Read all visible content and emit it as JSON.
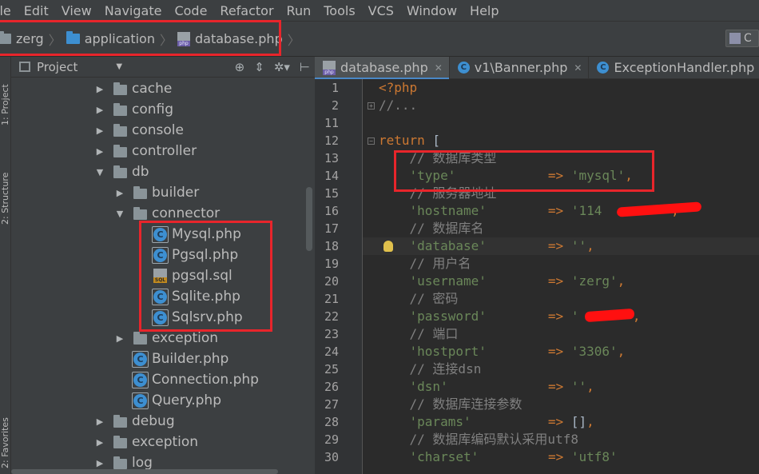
{
  "menu": [
    "ile",
    "Edit",
    "View",
    "Navigate",
    "Code",
    "Refactor",
    "Run",
    "Tools",
    "VCS",
    "Window",
    "Help"
  ],
  "breadcrumb": [
    {
      "label": "zerg",
      "icon": "folder-icon"
    },
    {
      "label": "application",
      "icon": "folder-icon"
    },
    {
      "label": "database.php",
      "icon": "php-file-icon"
    }
  ],
  "navbar_right_label": "C",
  "left_tabs": {
    "project": "1: Project",
    "structure": "2: Structure",
    "favorites": "2: Favorites"
  },
  "project_panel": {
    "title": "Project",
    "tools": [
      "⊕",
      "⇕",
      "✲▾",
      "⊢"
    ]
  },
  "tree": [
    {
      "label": "cache",
      "type": "folder",
      "depth": 0,
      "state": "collapsed"
    },
    {
      "label": "config",
      "type": "folder",
      "depth": 0,
      "state": "collapsed"
    },
    {
      "label": "console",
      "type": "folder",
      "depth": 0,
      "state": "collapsed"
    },
    {
      "label": "controller",
      "type": "folder",
      "depth": 0,
      "state": "collapsed"
    },
    {
      "label": "db",
      "type": "folder",
      "depth": 0,
      "state": "expanded"
    },
    {
      "label": "builder",
      "type": "folder",
      "depth": 1,
      "state": "collapsed"
    },
    {
      "label": "connector",
      "type": "folder",
      "depth": 1,
      "state": "expanded"
    },
    {
      "label": "Mysql.php",
      "type": "class",
      "depth": 2
    },
    {
      "label": "Pgsql.php",
      "type": "class",
      "depth": 2
    },
    {
      "label": "pgsql.sql",
      "type": "sql",
      "depth": 2
    },
    {
      "label": "Sqlite.php",
      "type": "class",
      "depth": 2
    },
    {
      "label": "Sqlsrv.php",
      "type": "class",
      "depth": 2
    },
    {
      "label": "exception",
      "type": "folder",
      "depth": 1,
      "state": "collapsed"
    },
    {
      "label": "Builder.php",
      "type": "class",
      "depth": 1
    },
    {
      "label": "Connection.php",
      "type": "class",
      "depth": 1
    },
    {
      "label": "Query.php",
      "type": "class",
      "depth": 1
    },
    {
      "label": "debug",
      "type": "folder",
      "depth": 0,
      "state": "collapsed"
    },
    {
      "label": "exception",
      "type": "folder",
      "depth": 0,
      "state": "collapsed"
    },
    {
      "label": "log",
      "type": "folder",
      "depth": 0,
      "state": "collapsed"
    }
  ],
  "tabs": [
    {
      "label": "database.php",
      "icon": "php-file-icon",
      "active": true
    },
    {
      "label": "v1\\Banner.php",
      "icon": "class-icon",
      "active": false
    },
    {
      "label": "ExceptionHandler.php",
      "icon": "class-icon",
      "active": false
    }
  ],
  "code_lines": [
    {
      "n": "1",
      "parts": [
        {
          "t": "<?php",
          "c": "kw"
        }
      ]
    },
    {
      "n": "2",
      "parts": [
        {
          "t": "//...",
          "c": "cmt"
        }
      ]
    },
    {
      "n": "11",
      "parts": []
    },
    {
      "n": "12",
      "parts": [
        {
          "t": "return",
          "c": "kw"
        },
        {
          "t": " [",
          "c": "pn"
        }
      ]
    },
    {
      "n": "13",
      "parts": [
        {
          "t": "    // 数据库类型",
          "c": "cmt"
        }
      ]
    },
    {
      "n": "14",
      "parts": [
        {
          "t": "    'type'",
          "c": "str"
        },
        {
          "t": "            ",
          "c": "pn"
        },
        {
          "t": "=>",
          "c": "arr"
        },
        {
          "t": " 'mysql'",
          "c": "str"
        },
        {
          "t": ",",
          "c": "arr"
        }
      ]
    },
    {
      "n": "15",
      "parts": [
        {
          "t": "    // 服务器地址",
          "c": "cmt"
        }
      ]
    },
    {
      "n": "16",
      "parts": [
        {
          "t": "    'hostname'",
          "c": "str"
        },
        {
          "t": "        ",
          "c": "pn"
        },
        {
          "t": "=>",
          "c": "arr"
        },
        {
          "t": " '114",
          "c": "str"
        },
        {
          "t": "         ",
          "c": "pn"
        },
        {
          "t": ",",
          "c": "arr"
        }
      ]
    },
    {
      "n": "17",
      "parts": [
        {
          "t": "    // 数据库名",
          "c": "cmt"
        }
      ]
    },
    {
      "n": "18",
      "parts": [
        {
          "t": "    'database'",
          "c": "str"
        },
        {
          "t": "        ",
          "c": "pn"
        },
        {
          "t": "=>",
          "c": "arr"
        },
        {
          "t": " ''",
          "c": "str"
        },
        {
          "t": ",",
          "c": "arr"
        }
      ]
    },
    {
      "n": "19",
      "parts": [
        {
          "t": "    // 用户名",
          "c": "cmt"
        }
      ]
    },
    {
      "n": "20",
      "parts": [
        {
          "t": "    'username'",
          "c": "str"
        },
        {
          "t": "        ",
          "c": "pn"
        },
        {
          "t": "=>",
          "c": "arr"
        },
        {
          "t": " 'zerg'",
          "c": "str"
        },
        {
          "t": ",",
          "c": "arr"
        }
      ]
    },
    {
      "n": "21",
      "parts": [
        {
          "t": "    // 密码",
          "c": "cmt"
        }
      ]
    },
    {
      "n": "22",
      "parts": [
        {
          "t": "    'password'",
          "c": "str"
        },
        {
          "t": "        ",
          "c": "pn"
        },
        {
          "t": "=>",
          "c": "arr"
        },
        {
          "t": " '",
          "c": "str"
        },
        {
          "t": "      ",
          "c": "pn"
        },
        {
          "t": "'",
          "c": "str"
        },
        {
          "t": ",",
          "c": "arr"
        }
      ]
    },
    {
      "n": "23",
      "parts": [
        {
          "t": "    // 端口",
          "c": "cmt"
        }
      ]
    },
    {
      "n": "24",
      "parts": [
        {
          "t": "    'hostport'",
          "c": "str"
        },
        {
          "t": "        ",
          "c": "pn"
        },
        {
          "t": "=>",
          "c": "arr"
        },
        {
          "t": " '3306'",
          "c": "str"
        },
        {
          "t": ",",
          "c": "arr"
        }
      ]
    },
    {
      "n": "25",
      "parts": [
        {
          "t": "    // 连接dsn",
          "c": "cmt"
        }
      ]
    },
    {
      "n": "26",
      "parts": [
        {
          "t": "    'dsn'",
          "c": "str"
        },
        {
          "t": "             ",
          "c": "pn"
        },
        {
          "t": "=>",
          "c": "arr"
        },
        {
          "t": " ''",
          "c": "str"
        },
        {
          "t": ",",
          "c": "arr"
        }
      ]
    },
    {
      "n": "27",
      "parts": [
        {
          "t": "    // 数据库连接参数",
          "c": "cmt"
        }
      ]
    },
    {
      "n": "28",
      "parts": [
        {
          "t": "    'params'",
          "c": "str"
        },
        {
          "t": "          ",
          "c": "pn"
        },
        {
          "t": "=>",
          "c": "arr"
        },
        {
          "t": " []",
          "c": "pn"
        },
        {
          "t": ",",
          "c": "arr"
        }
      ]
    },
    {
      "n": "29",
      "parts": [
        {
          "t": "    // 数据库编码默认采用utf8",
          "c": "cmt"
        }
      ]
    },
    {
      "n": "30",
      "parts": [
        {
          "t": "    'charset'",
          "c": "str"
        },
        {
          "t": "         ",
          "c": "pn"
        },
        {
          "t": "=>",
          "c": "arr"
        },
        {
          "t": " 'utf8'",
          "c": "str"
        }
      ]
    }
  ],
  "colors": {
    "annotation": "#e8252b",
    "redaction": "#ff1010"
  }
}
